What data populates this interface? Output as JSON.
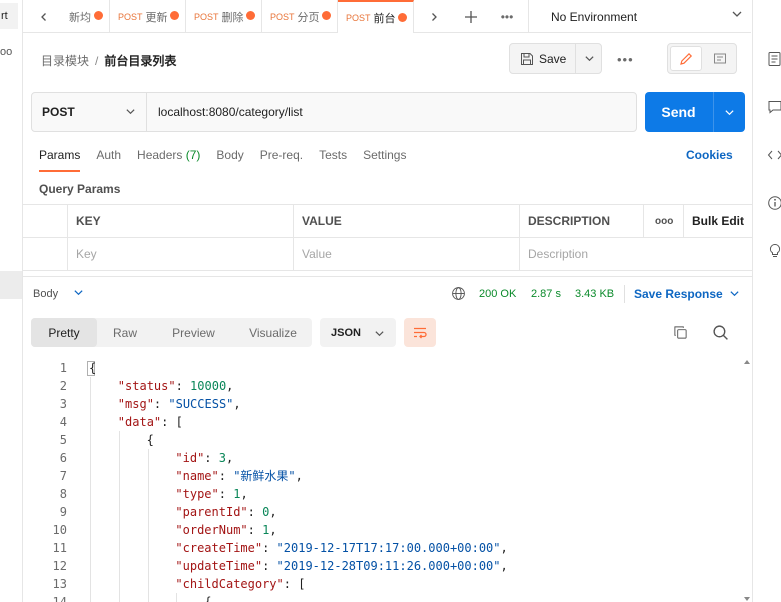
{
  "sidebar_left": {
    "partial_label": "rt",
    "more": "oo"
  },
  "tabs": {
    "items": [
      {
        "method": "",
        "label": "新均",
        "unsaved": true,
        "active": false
      },
      {
        "method": "POST",
        "label": "更新",
        "unsaved": true,
        "active": false
      },
      {
        "method": "POST",
        "label": "删除",
        "unsaved": true,
        "active": false
      },
      {
        "method": "POST",
        "label": "分页",
        "unsaved": true,
        "active": false
      },
      {
        "method": "POST",
        "label": "前台",
        "unsaved": true,
        "active": true
      }
    ],
    "environment": "No Environment"
  },
  "breadcrumb": {
    "parent": "目录模块",
    "separator": "/",
    "current": "前台目录列表"
  },
  "toolbar": {
    "save_label": "Save"
  },
  "request": {
    "method": "POST",
    "url": "localhost:8080/category/list",
    "send_label": "Send"
  },
  "request_tabs": [
    {
      "label": "Params",
      "count": "",
      "active": true
    },
    {
      "label": "Auth",
      "count": "",
      "active": false
    },
    {
      "label": "Headers",
      "count": "(7)",
      "active": false
    },
    {
      "label": "Body",
      "count": "",
      "active": false
    },
    {
      "label": "Pre-req.",
      "count": "",
      "active": false
    },
    {
      "label": "Tests",
      "count": "",
      "active": false
    },
    {
      "label": "Settings",
      "count": "",
      "active": false
    }
  ],
  "cookies_label": "Cookies",
  "query_params": {
    "title": "Query Params",
    "headers": {
      "key": "KEY",
      "value": "VALUE",
      "description": "DESCRIPTION",
      "more": "ooo",
      "bulk_edit": "Bulk Edit"
    },
    "placeholders": {
      "key": "Key",
      "value": "Value",
      "description": "Description"
    }
  },
  "response": {
    "body_label": "Body",
    "status": "200 OK",
    "time": "2.87 s",
    "size": "3.43 KB",
    "save_response": "Save Response",
    "views": [
      "Pretty",
      "Raw",
      "Preview",
      "Visualize"
    ],
    "active_view": "Pretty",
    "format": "JSON",
    "code_lines": [
      {
        "n": "1",
        "indent": 0,
        "parts": [
          [
            "p",
            "{"
          ]
        ]
      },
      {
        "n": "2",
        "indent": 1,
        "parts": [
          [
            "k",
            "\"status\""
          ],
          [
            "p",
            ": "
          ],
          [
            "n",
            "10000"
          ],
          [
            "p",
            ","
          ]
        ]
      },
      {
        "n": "3",
        "indent": 1,
        "parts": [
          [
            "k",
            "\"msg\""
          ],
          [
            "p",
            ": "
          ],
          [
            "s",
            "\"SUCCESS\""
          ],
          [
            "p",
            ","
          ]
        ]
      },
      {
        "n": "4",
        "indent": 1,
        "parts": [
          [
            "k",
            "\"data\""
          ],
          [
            "p",
            ": ["
          ]
        ]
      },
      {
        "n": "5",
        "indent": 2,
        "parts": [
          [
            "p",
            "{"
          ]
        ]
      },
      {
        "n": "6",
        "indent": 3,
        "parts": [
          [
            "k",
            "\"id\""
          ],
          [
            "p",
            ": "
          ],
          [
            "n",
            "3"
          ],
          [
            "p",
            ","
          ]
        ]
      },
      {
        "n": "7",
        "indent": 3,
        "parts": [
          [
            "k",
            "\"name\""
          ],
          [
            "p",
            ": "
          ],
          [
            "s",
            "\"新鲜水果\""
          ],
          [
            "p",
            ","
          ]
        ]
      },
      {
        "n": "8",
        "indent": 3,
        "parts": [
          [
            "k",
            "\"type\""
          ],
          [
            "p",
            ": "
          ],
          [
            "n",
            "1"
          ],
          [
            "p",
            ","
          ]
        ]
      },
      {
        "n": "9",
        "indent": 3,
        "parts": [
          [
            "k",
            "\"parentId\""
          ],
          [
            "p",
            ": "
          ],
          [
            "n",
            "0"
          ],
          [
            "p",
            ","
          ]
        ]
      },
      {
        "n": "10",
        "indent": 3,
        "parts": [
          [
            "k",
            "\"orderNum\""
          ],
          [
            "p",
            ": "
          ],
          [
            "n",
            "1"
          ],
          [
            "p",
            ","
          ]
        ]
      },
      {
        "n": "11",
        "indent": 3,
        "parts": [
          [
            "k",
            "\"createTime\""
          ],
          [
            "p",
            ": "
          ],
          [
            "s",
            "\"2019-12-17T17:17:00.000+00:00\""
          ],
          [
            "p",
            ","
          ]
        ]
      },
      {
        "n": "12",
        "indent": 3,
        "parts": [
          [
            "k",
            "\"updateTime\""
          ],
          [
            "p",
            ": "
          ],
          [
            "s",
            "\"2019-12-28T09:11:26.000+00:00\""
          ],
          [
            "p",
            ","
          ]
        ]
      },
      {
        "n": "13",
        "indent": 3,
        "parts": [
          [
            "k",
            "\"childCategory\""
          ],
          [
            "p",
            ": ["
          ]
        ]
      },
      {
        "n": "14",
        "indent": 4,
        "parts": [
          [
            "p",
            "{"
          ]
        ]
      }
    ]
  },
  "colors": {
    "accent": "#ff6c37",
    "primary": "#0d7ae7",
    "success": "#0a8a2a",
    "link": "#0d66c2"
  }
}
